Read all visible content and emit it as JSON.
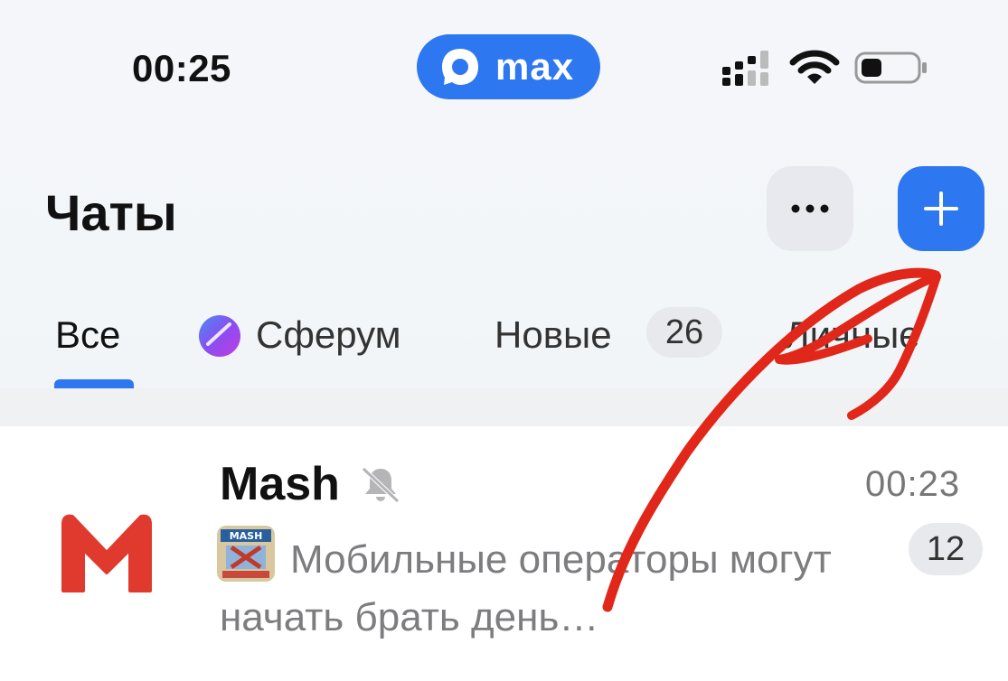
{
  "status_bar": {
    "time": "00:25",
    "app_badge": "max"
  },
  "header": {
    "title": "Чаты"
  },
  "tabs": [
    {
      "label": "Все"
    },
    {
      "label": "Сферум"
    },
    {
      "label": "Новые",
      "badge": "26"
    },
    {
      "label": "Личные"
    }
  ],
  "chats": [
    {
      "name": "Mash",
      "time": "00:23",
      "preview": "Мобильные операторы могут начать брать день…",
      "unread": "12",
      "avatar_letter": "M",
      "thumb_text": "MASH"
    }
  ],
  "colors": {
    "accent": "#2d77f0",
    "annotation": "#e0271a"
  }
}
